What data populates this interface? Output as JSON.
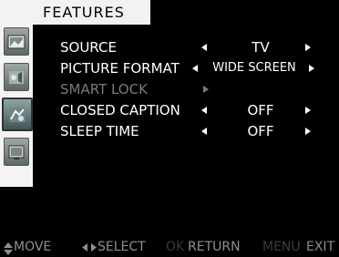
{
  "menu": {
    "title": "FEATURES",
    "items": [
      {
        "label": "SOURCE",
        "value": "TV",
        "enabled": true
      },
      {
        "label": "PICTURE FORMAT",
        "value": "WIDE SCREEN",
        "enabled": true
      },
      {
        "label": "SMART LOCK",
        "value": "",
        "enabled": false
      },
      {
        "label": "CLOSED CAPTION",
        "value": "OFF",
        "enabled": true
      },
      {
        "label": "SLEEP TIME",
        "value": "OFF",
        "enabled": true
      }
    ]
  },
  "sidebar": {
    "icons": [
      "picture-icon",
      "sound-icon",
      "features-icon",
      "install-icon"
    ],
    "selected_icon": "features-icon"
  },
  "footer": {
    "move_label": "MOVE",
    "select_label": "SELECT",
    "ok_key": "OK",
    "return_label": "RETURN",
    "menu_key": "MENU",
    "exit_label": "EXIT"
  },
  "colors": {
    "background": "#000000",
    "text": "#ffffff",
    "disabled_text": "#7a7a7a",
    "title_bar": "#f2f2f2",
    "footer_text": "#8e8e8e",
    "footer_dim_text": "#3c3c3c"
  }
}
